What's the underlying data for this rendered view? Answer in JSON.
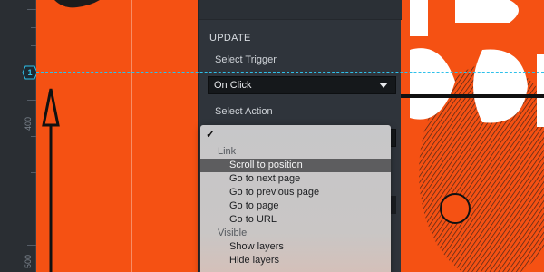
{
  "ruler": {
    "labels": [
      "400",
      "500"
    ],
    "guide_marker": "1"
  },
  "panel": {
    "section_title": "UPDATE",
    "trigger_label": "Select Trigger",
    "trigger_value": "On Click",
    "action_label": "Select Action"
  },
  "menu": {
    "check_mark": "✓",
    "groups": [
      {
        "label": "Link",
        "items": [
          "Scroll to position",
          "Go to next page",
          "Go to previous page",
          "Go to page",
          "Go to URL"
        ]
      },
      {
        "label": "Visible",
        "items": [
          "Show layers",
          "Hide layers"
        ]
      }
    ],
    "selected_item": "Scroll to position"
  },
  "colors": {
    "accent_orange": "#f55113",
    "guide_cyan": "#2ec0ea",
    "panel_bg": "#2f343b",
    "menu_bg": "#c7c7c9",
    "menu_highlight": "#5d5d5f"
  }
}
